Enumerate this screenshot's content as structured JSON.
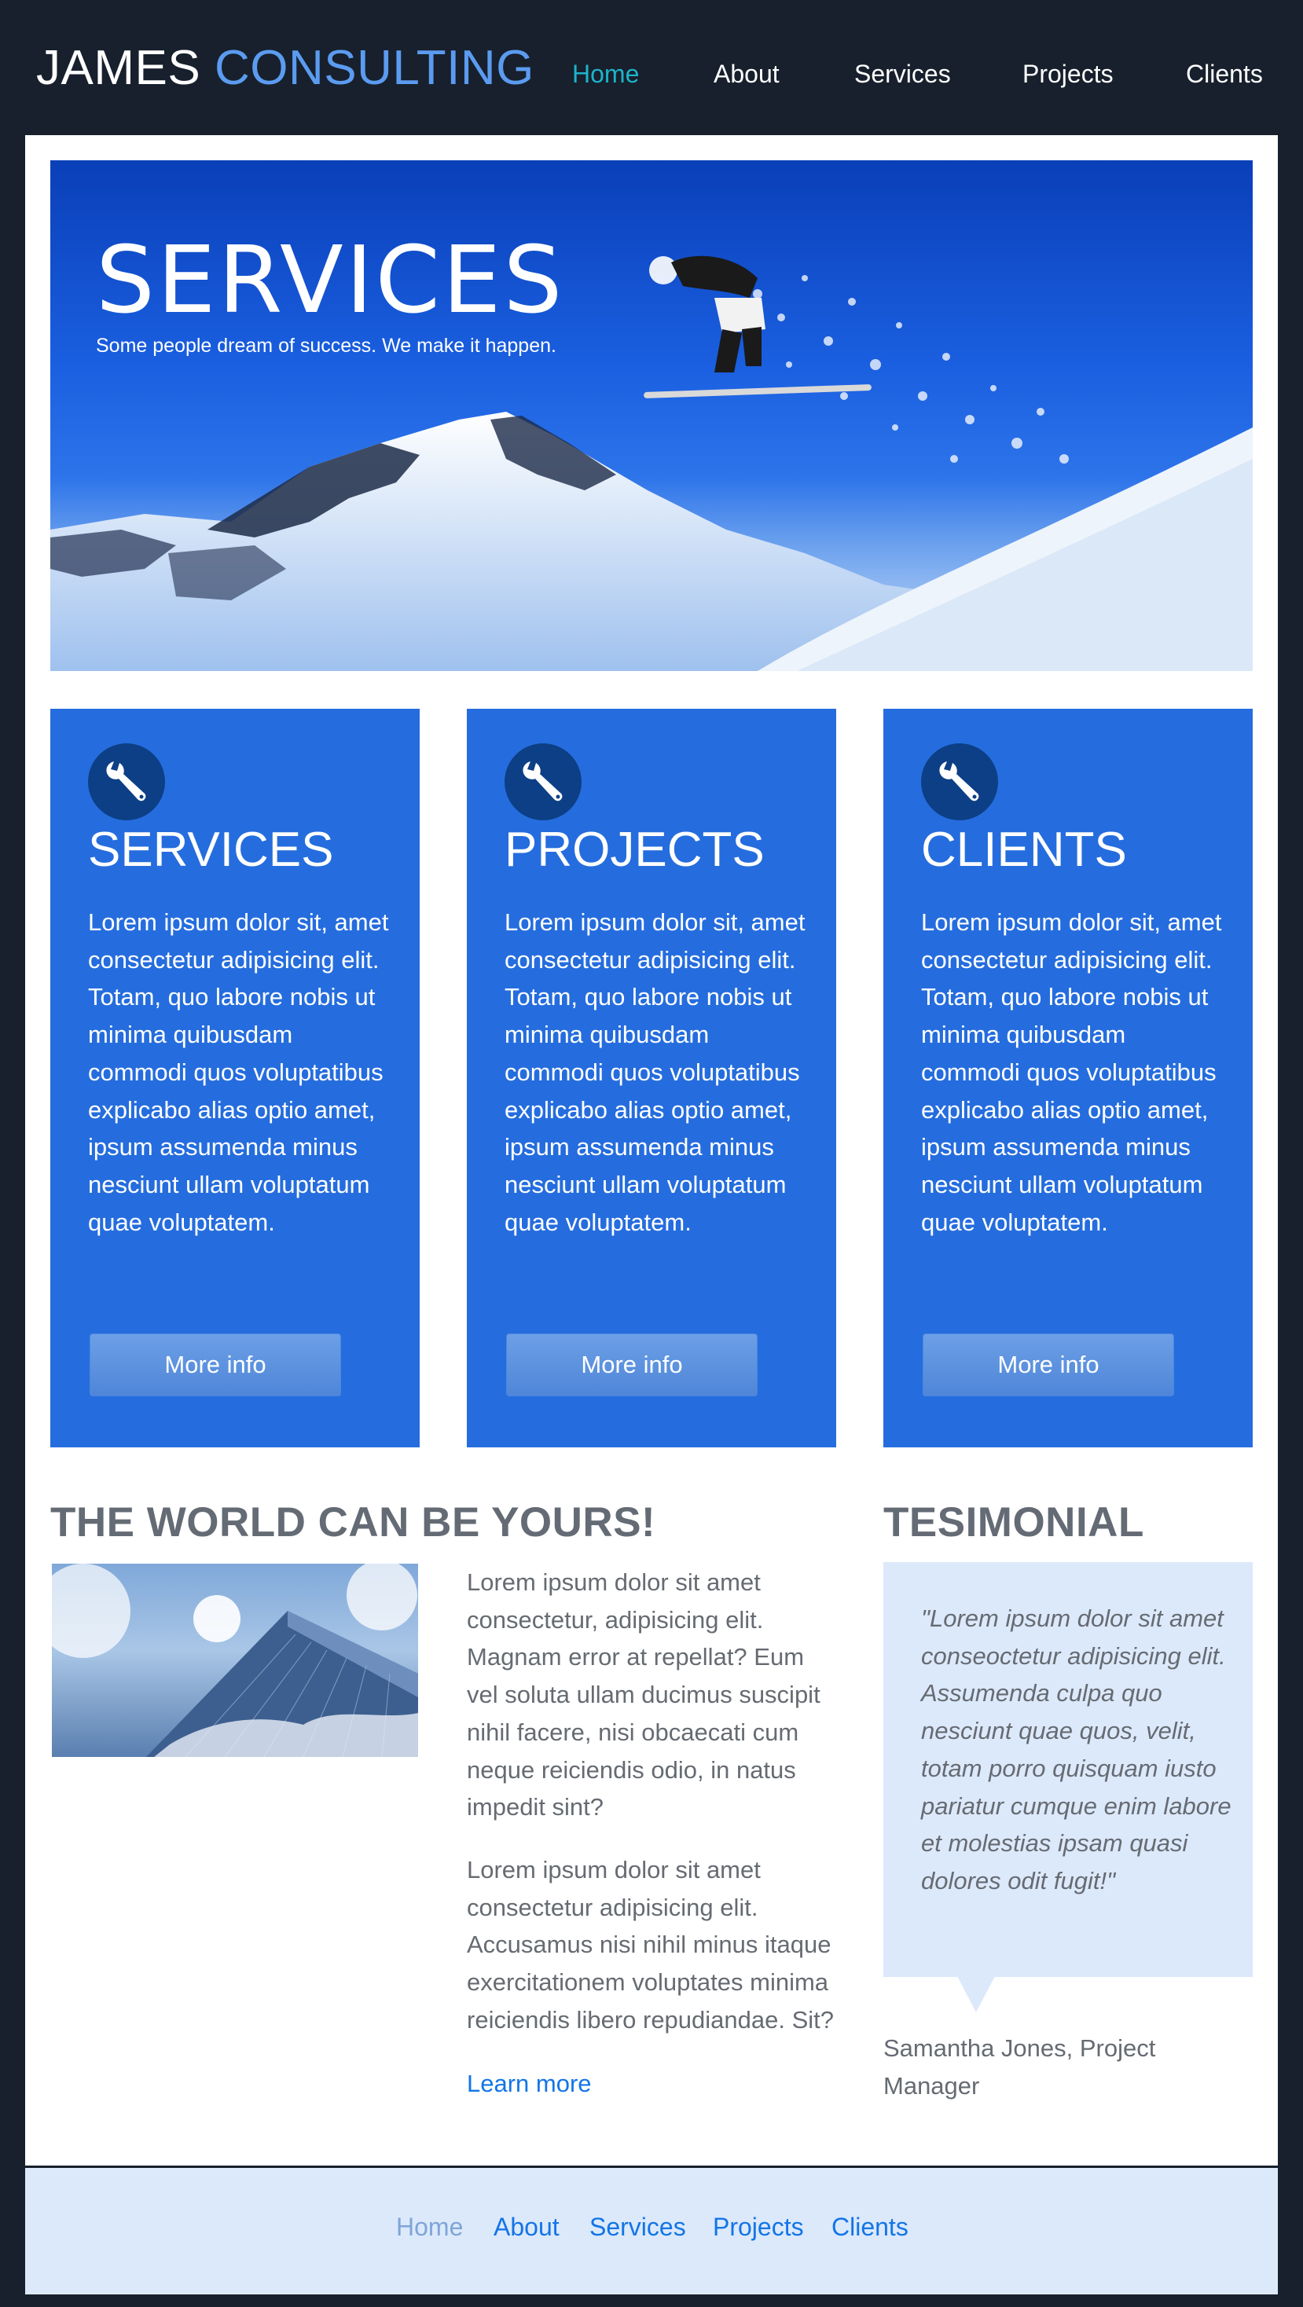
{
  "header": {
    "brand_main": "JAMES",
    "brand_accent": "CONSULTING",
    "nav": [
      "Home",
      "About",
      "Services",
      "Projects",
      "Clients"
    ],
    "active": "Home"
  },
  "hero": {
    "title": "SERVICES",
    "subtitle": "Some people dream of success. We make it happen."
  },
  "cards": [
    {
      "icon": "wrench-icon",
      "title": "SERVICES",
      "text": "Lorem ipsum dolor sit, amet consectetur adipisicing elit. Totam, quo labore nobis ut minima quibusdam commodi quos voluptatibus explicabo alias optio amet, ipsum assumenda minus nesciunt ullam voluptatum quae voluptatem.",
      "button": "More info"
    },
    {
      "icon": "wrench-icon",
      "title": "PROJECTS",
      "text": "Lorem ipsum dolor sit, amet consectetur adipisicing elit. Totam, quo labore nobis ut minima quibusdam commodi quos voluptatibus explicabo alias optio amet, ipsum assumenda minus nesciunt ullam voluptatum quae voluptatem.",
      "button": "More info"
    },
    {
      "icon": "wrench-icon",
      "title": "CLIENTS",
      "text": "Lorem ipsum dolor sit, amet consectetur adipisicing elit. Totam, quo labore nobis ut minima quibusdam commodi quos voluptatibus explicabo alias optio amet, ipsum assumenda minus nesciunt ullam voluptatum quae voluptatem.",
      "button": "More info"
    }
  ],
  "world": {
    "title": "THE WORLD CAN BE YOURS!",
    "paragraph1": "Lorem ipsum dolor sit amet consectetur, adipisicing elit. Magnam error at repellat? Eum vel soluta ullam ducimus suscipit nihil facere, nisi obcaecati cum neque reiciendis odio, in natus impedit sint?",
    "paragraph2": "Lorem ipsum dolor sit amet consectetur adipisicing elit. Accusamus nisi nihil minus itaque exercitationem voluptates minima reiciendis libero repudiandae. Sit?",
    "link": "Learn more"
  },
  "testimonial": {
    "title": "TESIMONIAL",
    "quote": "\"Lorem ipsum dolor sit amet conseoctetur adipisicing elit. Assumenda culpa quo nesciunt quae quos, velit, totam porro quisquam iusto pariatur cumque enim labore et molestias ipsam quasi dolores odit fugit!\"",
    "author": "Samantha Jones, Project Manager"
  },
  "footer": {
    "nav": [
      "Home",
      "About",
      "Services",
      "Projects",
      "Clients"
    ],
    "active": "Home"
  },
  "colors": {
    "background": "#17202c",
    "accent": "#5b9bf0",
    "active_nav": "#1eb3cb",
    "card": "#256dde",
    "link": "#1375e6",
    "light_panel": "#dce9fb"
  }
}
